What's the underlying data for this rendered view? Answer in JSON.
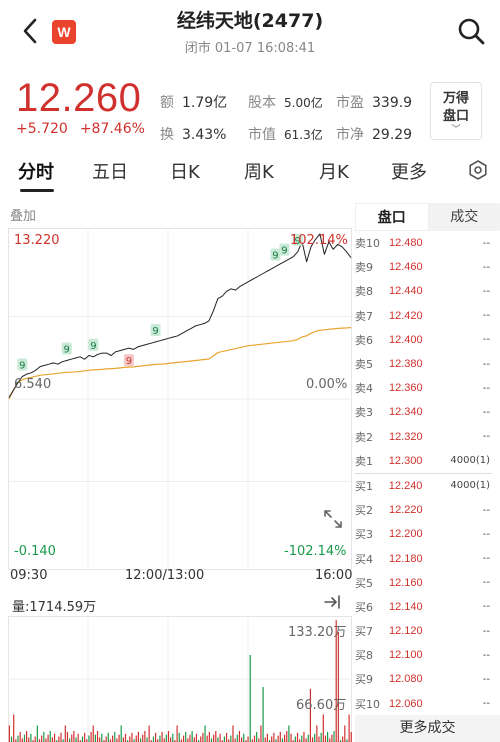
{
  "header": {
    "title": "经纬天地(2477)",
    "subtitle": "闭市 01-07 16:08:41",
    "logo_letter": "W"
  },
  "quote": {
    "price": "12.260",
    "change": "+5.720",
    "change_pct": "+87.46%",
    "stats": [
      {
        "key": "额",
        "value": "1.79亿"
      },
      {
        "key": "股本",
        "value": "5.00亿"
      },
      {
        "key": "市盈",
        "value": "339.9"
      },
      {
        "key": "换",
        "value": "3.43%"
      },
      {
        "key": "市值",
        "value": "61.3亿"
      },
      {
        "key": "市净",
        "value": "29.29"
      }
    ],
    "wande_label_1": "万得",
    "wande_label_2": "盘口"
  },
  "tabs": [
    "分时",
    "五日",
    "日K",
    "周K",
    "月K",
    "更多"
  ],
  "chart": {
    "overlay_label": "叠加",
    "high_price": "13.220",
    "high_pct": "102.14%",
    "low_price": "6.540",
    "zero_pct": "0.00%",
    "neg_price": "-0.140",
    "neg_pct": "-102.14%",
    "time_start": "09:30",
    "time_mid": "12:00/13:00",
    "time_end": "16:00",
    "marker_label": "9",
    "volume_label": "量:1714.59万",
    "vol_max": "133.20万",
    "vol_mid": "66.60万"
  },
  "chart_data": {
    "type": "line",
    "title": "",
    "series": [
      {
        "values": [
          6.6,
          6.9,
          7.2,
          7.45,
          7.55,
          7.6,
          7.7,
          7.85,
          7.9,
          7.95,
          8.0,
          7.95,
          8.05,
          8.1,
          8.15,
          8.2,
          8.25,
          8.15,
          8.3,
          8.25,
          8.35,
          8.4,
          8.4,
          8.3,
          8.45,
          8.5,
          8.55,
          8.6,
          8.55,
          8.65,
          8.7,
          8.75,
          8.8,
          8.85,
          8.9,
          8.95,
          9.0,
          9.05,
          9.1,
          9.2,
          9.3,
          9.4,
          9.5,
          9.55,
          9.6,
          9.7,
          10.1,
          10.6,
          10.7,
          10.9,
          11.0,
          10.95,
          11.1,
          11.2,
          11.3,
          11.4,
          11.5,
          11.6,
          11.7,
          11.8,
          11.9,
          12.0,
          12.1,
          12.2,
          12.3,
          12.5,
          12.9,
          12.1,
          12.7,
          13.0,
          13.22,
          12.4,
          12.9,
          12.6,
          12.8,
          12.7,
          12.5,
          12.26
        ]
      },
      {
        "values": [
          6.54,
          6.9,
          7.2,
          7.32,
          7.38,
          7.42,
          7.46,
          7.5,
          7.52,
          7.54,
          7.56,
          7.58,
          7.6,
          7.62,
          7.63,
          7.64,
          7.66,
          7.68,
          7.7,
          7.72,
          7.73,
          7.74,
          7.76,
          7.77,
          7.78,
          7.8,
          7.82,
          7.83,
          7.84,
          7.86,
          7.88,
          7.9,
          7.92,
          7.94,
          7.95,
          7.96,
          7.98,
          8.0,
          8.02,
          8.04,
          8.06,
          8.08,
          8.1,
          8.12,
          8.14,
          8.16,
          8.28,
          8.42,
          8.46,
          8.5,
          8.54,
          8.58,
          8.62,
          8.66,
          8.7,
          8.72,
          8.74,
          8.76,
          8.78,
          8.8,
          8.82,
          8.84,
          8.86,
          8.88,
          8.9,
          8.95,
          9.05,
          9.1,
          9.2,
          9.28,
          9.32,
          9.34,
          9.36,
          9.38,
          9.4,
          9.41,
          9.42,
          9.43
        ]
      }
    ],
    "ylim": [
      -0.14,
      13.22
    ],
    "volume_ylim": [
      0,
      133.2
    ],
    "volume_unit": "万",
    "x_ticks": [
      "09:30",
      "12:00/13:00",
      "16:00"
    ],
    "grid": true
  },
  "orderbook": {
    "tab_active": "盘口",
    "tab_other": "成交",
    "asks": [
      {
        "label": "卖10",
        "price": "12.480",
        "qty": "--"
      },
      {
        "label": "卖9",
        "price": "12.460",
        "qty": "--"
      },
      {
        "label": "卖8",
        "price": "12.440",
        "qty": "--"
      },
      {
        "label": "卖7",
        "price": "12.420",
        "qty": "--"
      },
      {
        "label": "卖6",
        "price": "12.400",
        "qty": "--"
      },
      {
        "label": "卖5",
        "price": "12.380",
        "qty": "--"
      },
      {
        "label": "卖4",
        "price": "12.360",
        "qty": "--"
      },
      {
        "label": "卖3",
        "price": "12.340",
        "qty": "--"
      },
      {
        "label": "卖2",
        "price": "12.320",
        "qty": "--"
      },
      {
        "label": "卖1",
        "price": "12.300",
        "qty": "4000(1)"
      }
    ],
    "bids": [
      {
        "label": "买1",
        "price": "12.240",
        "qty": "4000(1)"
      },
      {
        "label": "买2",
        "price": "12.220",
        "qty": "--"
      },
      {
        "label": "买3",
        "price": "12.200",
        "qty": "--"
      },
      {
        "label": "买4",
        "price": "12.180",
        "qty": "--"
      },
      {
        "label": "买5",
        "price": "12.160",
        "qty": "--"
      },
      {
        "label": "买6",
        "price": "12.140",
        "qty": "--"
      },
      {
        "label": "买7",
        "price": "12.120",
        "qty": "--"
      },
      {
        "label": "买8",
        "price": "12.100",
        "qty": "--"
      },
      {
        "label": "买9",
        "price": "12.080",
        "qty": "--"
      },
      {
        "label": "买10",
        "price": "12.060",
        "qty": "--"
      }
    ],
    "more_label": "更多成交"
  },
  "colors": {
    "up": "#d0312d",
    "down": "#1a9a4a",
    "avg": "#e8a530",
    "price_line": "#222222"
  }
}
